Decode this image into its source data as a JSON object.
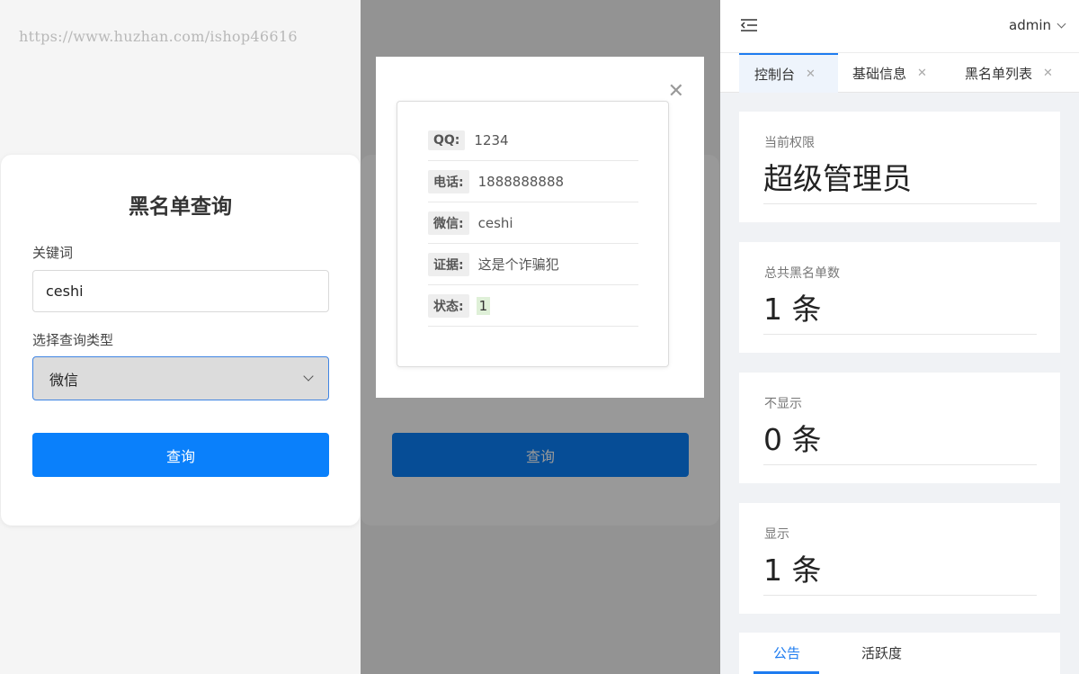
{
  "watermark": "https://www.huzhan.com/ishop46616",
  "query_form": {
    "title": "黑名单查询",
    "keyword_label": "关键词",
    "keyword_value": "ceshi",
    "type_label": "选择查询类型",
    "type_selected": "微信",
    "submit_label": "查询"
  },
  "result_modal": {
    "close_symbol": "✕",
    "rows": [
      {
        "key": "QQ:",
        "value": "1234"
      },
      {
        "key": "电话:",
        "value": "1888888888"
      },
      {
        "key": "微信:",
        "value": "ceshi"
      },
      {
        "key": "证据:",
        "value": "这是个诈骗犯"
      },
      {
        "key": "状态:",
        "value": "1"
      }
    ]
  },
  "admin_panel": {
    "user": "admin",
    "tabs": [
      {
        "label": "控制台"
      },
      {
        "label": "基础信息"
      },
      {
        "label": "黑名单列表"
      }
    ],
    "stats": [
      {
        "label": "当前权限",
        "value": "超级管理员"
      },
      {
        "label": "总共黑名单数",
        "value": "1 条"
      },
      {
        "label": "不显示",
        "value": "0 条"
      },
      {
        "label": "显示",
        "value": "1 条"
      }
    ],
    "bottom_tabs": [
      {
        "label": "公告"
      },
      {
        "label": "活跃度"
      }
    ]
  },
  "colors": {
    "primary": "#0a80fb",
    "tab_accent": "#1e7cf0",
    "status_bg": "#dff0d8"
  }
}
